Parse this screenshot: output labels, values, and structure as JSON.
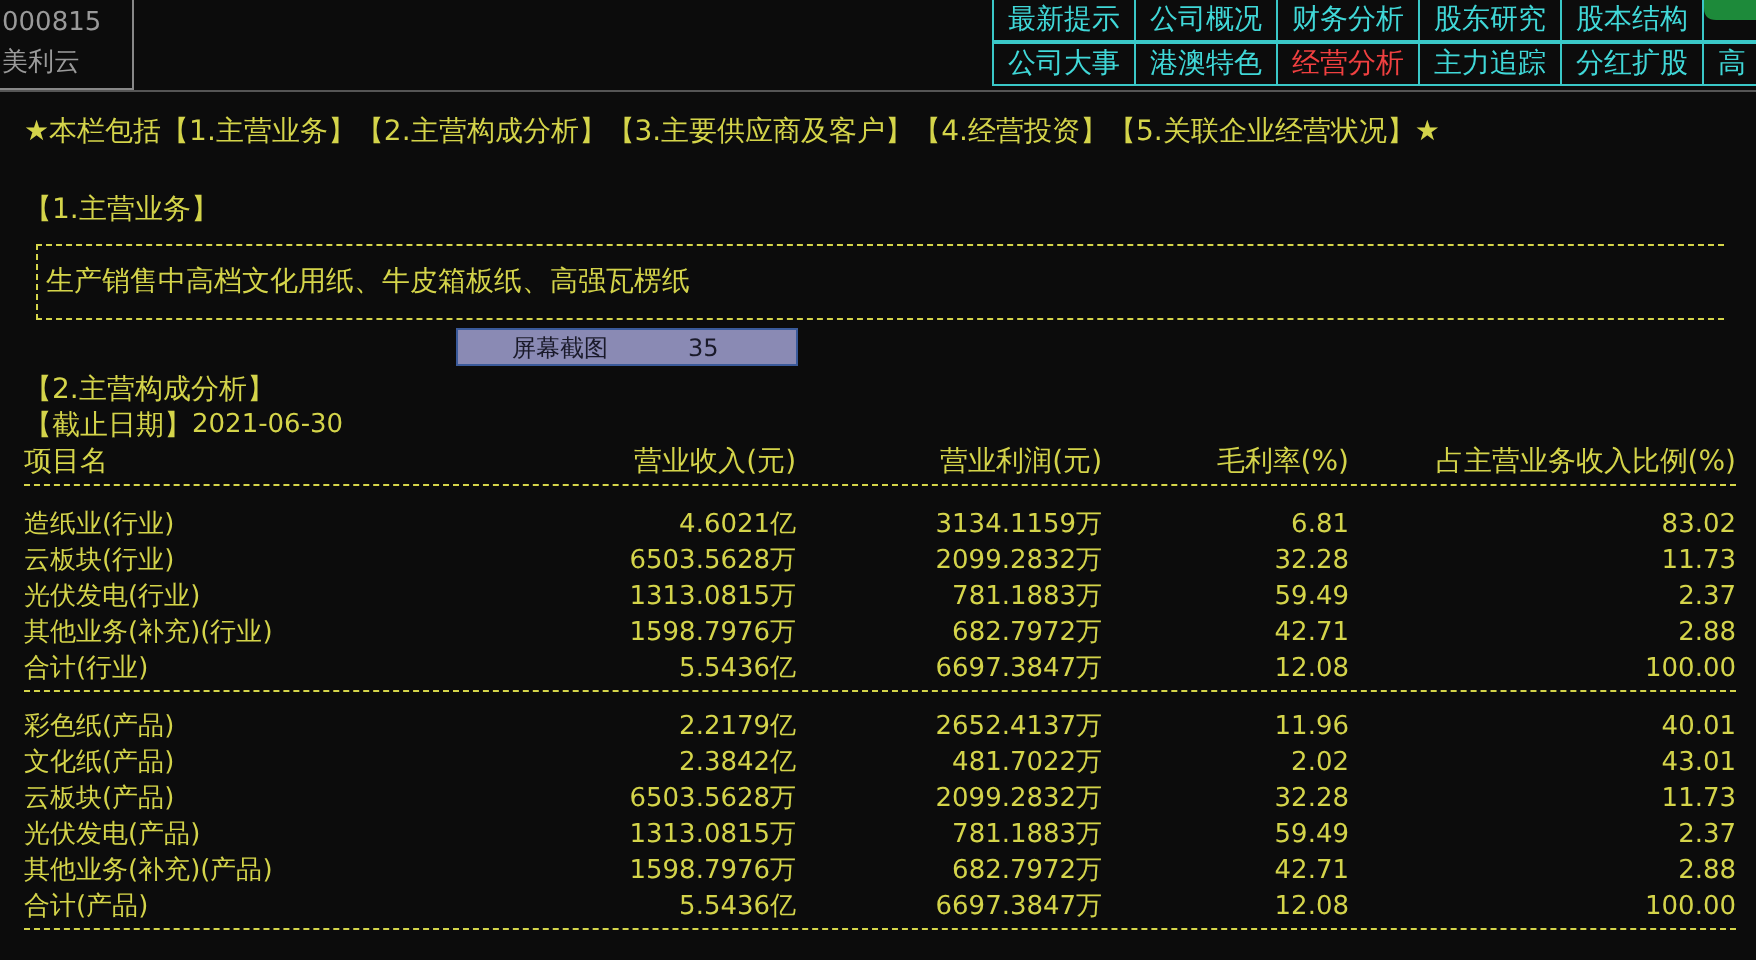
{
  "stock": {
    "code": "000815",
    "name": "美利云"
  },
  "nav_tabs": [
    [
      {
        "label": "最新提示",
        "selected": false
      },
      {
        "label": "公司概况",
        "selected": false
      },
      {
        "label": "财务分析",
        "selected": false
      },
      {
        "label": "股东研究",
        "selected": false
      },
      {
        "label": "股本结构",
        "selected": false
      }
    ],
    [
      {
        "label": "公司大事",
        "selected": false
      },
      {
        "label": "港澳特色",
        "selected": false
      },
      {
        "label": "经营分析",
        "selected": true
      },
      {
        "label": "主力追踪",
        "selected": false
      },
      {
        "label": "分红扩股",
        "selected": false
      },
      {
        "label": "高",
        "selected": false
      }
    ]
  ],
  "intro": "★本栏包括【1.主营业务】【2.主营构成分析】【3.主要供应商及客户】【4.经营投资】【5.关联企业经营状况】★",
  "section1": {
    "title": "【1.主营业务】",
    "text": "生产销售中高档文化用纸、牛皮箱板纸、高强瓦楞纸"
  },
  "overlay": {
    "label": "屏幕截图",
    "count": "35"
  },
  "section2": {
    "title": "【2.主营构成分析】",
    "date_label": "【截止日期】",
    "date": "2021-06-30",
    "columns": [
      "项目名",
      "营业收入(元)",
      "营业利润(元)",
      "毛利率(%)",
      "占主营业务收入比例(%)"
    ],
    "groups": [
      [
        [
          "造纸业(行业)",
          "4.6021亿",
          "3134.1159万",
          "6.81",
          "83.02"
        ],
        [
          "云板块(行业)",
          "6503.5628万",
          "2099.2832万",
          "32.28",
          "11.73"
        ],
        [
          "光伏发电(行业)",
          "1313.0815万",
          "781.1883万",
          "59.49",
          "2.37"
        ],
        [
          "其他业务(补充)(行业)",
          "1598.7976万",
          "682.7972万",
          "42.71",
          "2.88"
        ],
        [
          "合计(行业)",
          "5.5436亿",
          "6697.3847万",
          "12.08",
          "100.00"
        ]
      ],
      [
        [
          "彩色纸(产品)",
          "2.2179亿",
          "2652.4137万",
          "11.96",
          "40.01"
        ],
        [
          "文化纸(产品)",
          "2.3842亿",
          "481.7022万",
          "2.02",
          "43.01"
        ],
        [
          "云板块(产品)",
          "6503.5628万",
          "2099.2832万",
          "32.28",
          "11.73"
        ],
        [
          "光伏发电(产品)",
          "1313.0815万",
          "781.1883万",
          "59.49",
          "2.37"
        ],
        [
          "其他业务(补充)(产品)",
          "1598.7976万",
          "682.7972万",
          "42.71",
          "2.88"
        ],
        [
          "合计(产品)",
          "5.5436亿",
          "6697.3847万",
          "12.08",
          "100.00"
        ]
      ]
    ]
  }
}
